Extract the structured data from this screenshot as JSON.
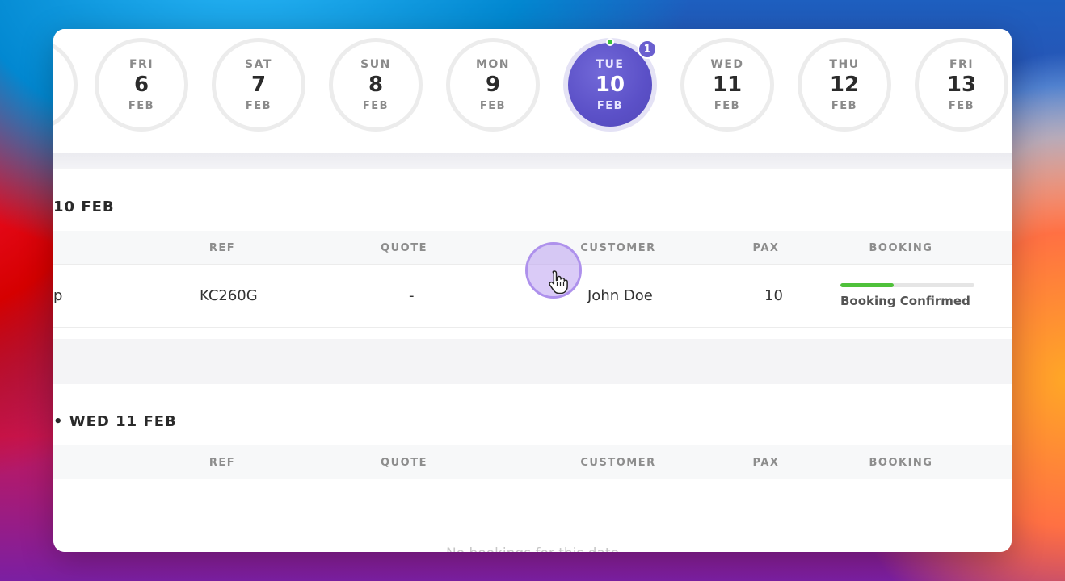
{
  "dates": [
    {
      "dow": "FRI",
      "day": "6",
      "mon": "FEB"
    },
    {
      "dow": "SAT",
      "day": "7",
      "mon": "FEB"
    },
    {
      "dow": "SUN",
      "day": "8",
      "mon": "FEB"
    },
    {
      "dow": "MON",
      "day": "9",
      "mon": "FEB"
    },
    {
      "dow": "TUE",
      "day": "10",
      "mon": "FEB",
      "selected": true,
      "badge": "1"
    },
    {
      "dow": "WED",
      "day": "11",
      "mon": "FEB"
    },
    {
      "dow": "THU",
      "day": "12",
      "mon": "FEB"
    },
    {
      "dow": "FRI",
      "day": "13",
      "mon": "FEB"
    }
  ],
  "columns": {
    "ref": "REF",
    "quote": "QUOTE",
    "customer": "CUSTOMER",
    "pax": "PAX",
    "booking": "BOOKING"
  },
  "sections": [
    {
      "title": "10 FEB",
      "row": {
        "name_fragment": "p",
        "ref": "KC260G",
        "quote": "-",
        "customer": "John Doe",
        "pax": "10",
        "booking_progress": 0.4,
        "booking_status": "Booking Confirmed"
      }
    },
    {
      "title": "• WED 11 FEB",
      "empty_message": "No bookings for this date"
    }
  ],
  "colors": {
    "selected_date": "#5b50c7",
    "badge": "#6a5fcf",
    "progress": "#4fc13a",
    "dot": "#3cc23c"
  }
}
